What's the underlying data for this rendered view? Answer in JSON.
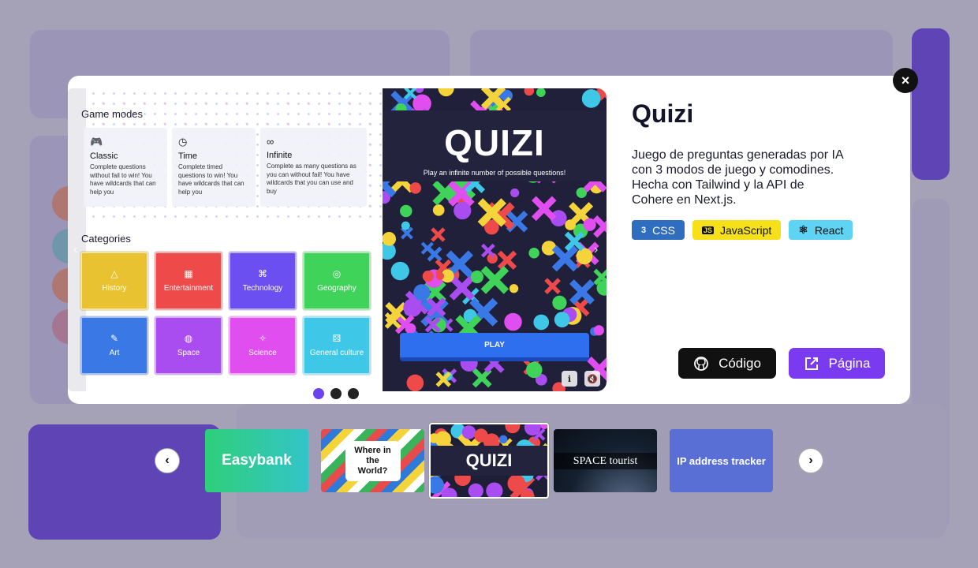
{
  "modal": {
    "close_label": "×",
    "screenshot": {
      "game_modes_title": "Game modes",
      "modes": [
        {
          "icon": "gamepad-icon",
          "glyph": "🎮",
          "name": "Classic",
          "desc": "Complete questions without fail to win! You have wildcards that can help you"
        },
        {
          "icon": "clock-icon",
          "glyph": "◷",
          "name": "Time",
          "desc": "Complete timed questions to win! You have wildcards that can help you"
        },
        {
          "icon": "infinity-icon",
          "glyph": "∞",
          "name": "Infinite",
          "desc": "Complete as many questions as you can without fail! You have wildcards that you can use and buy"
        }
      ],
      "categories_title": "Categories",
      "categories": [
        {
          "name": "History",
          "icon": "pyramid-icon",
          "glyph": "△",
          "color": "#e8c230"
        },
        {
          "name": "Entertainment",
          "icon": "film-icon",
          "glyph": "▦",
          "color": "#ef4a4a"
        },
        {
          "name": "Technology",
          "icon": "nodes-icon",
          "glyph": "⌘",
          "color": "#6b4ff0"
        },
        {
          "name": "Geography",
          "icon": "globe-icon",
          "glyph": "◎",
          "color": "#3fd35a"
        },
        {
          "name": "Art",
          "icon": "brush-icon",
          "glyph": "✎",
          "color": "#3a78e6"
        },
        {
          "name": "Space",
          "icon": "planet-icon",
          "glyph": "◍",
          "color": "#a94cf0"
        },
        {
          "name": "Science",
          "icon": "sparkle-icon",
          "glyph": "✧",
          "color": "#e04ef0"
        },
        {
          "name": "General culture",
          "icon": "dice-icon",
          "glyph": "⚄",
          "color": "#3fc7e8"
        }
      ],
      "quizi_title": "QUIZI",
      "quizi_subtitle": "Play an infinite number of possible questions!",
      "play_label": "PLAY",
      "info_icon": "ℹ",
      "mute_icon": "🔇"
    },
    "carousel_dots": 3,
    "active_dot": 0,
    "project": {
      "title": "Quizi",
      "description": "Juego de preguntas generadas por IA con 3 modos de juego y comodines. Hecha con Tailwind y la API de Cohere en Next.js.",
      "tags": [
        {
          "label": "CSS",
          "icon": "css3-icon",
          "glyph": "3",
          "bg": "#2f6dbe",
          "fg": "#ffffff"
        },
        {
          "label": "JavaScript",
          "icon": "js-icon",
          "glyph": "JS",
          "bg": "#f5e01a",
          "fg": "#111111"
        },
        {
          "label": "React",
          "icon": "react-icon",
          "glyph": "⚛",
          "bg": "#5fd3f3",
          "fg": "#111111"
        }
      ],
      "code_label": "Código",
      "page_label": "Página"
    }
  },
  "thumbnails": [
    {
      "label": "Easybank",
      "selected": false
    },
    {
      "label": "Where in the World?",
      "selected": false
    },
    {
      "label": "QUIZI",
      "selected": true
    },
    {
      "label": "SPACE tourist",
      "selected": false
    },
    {
      "label": "IP address tracker",
      "selected": false
    }
  ],
  "nav": {
    "prev": "‹",
    "next": "›"
  }
}
